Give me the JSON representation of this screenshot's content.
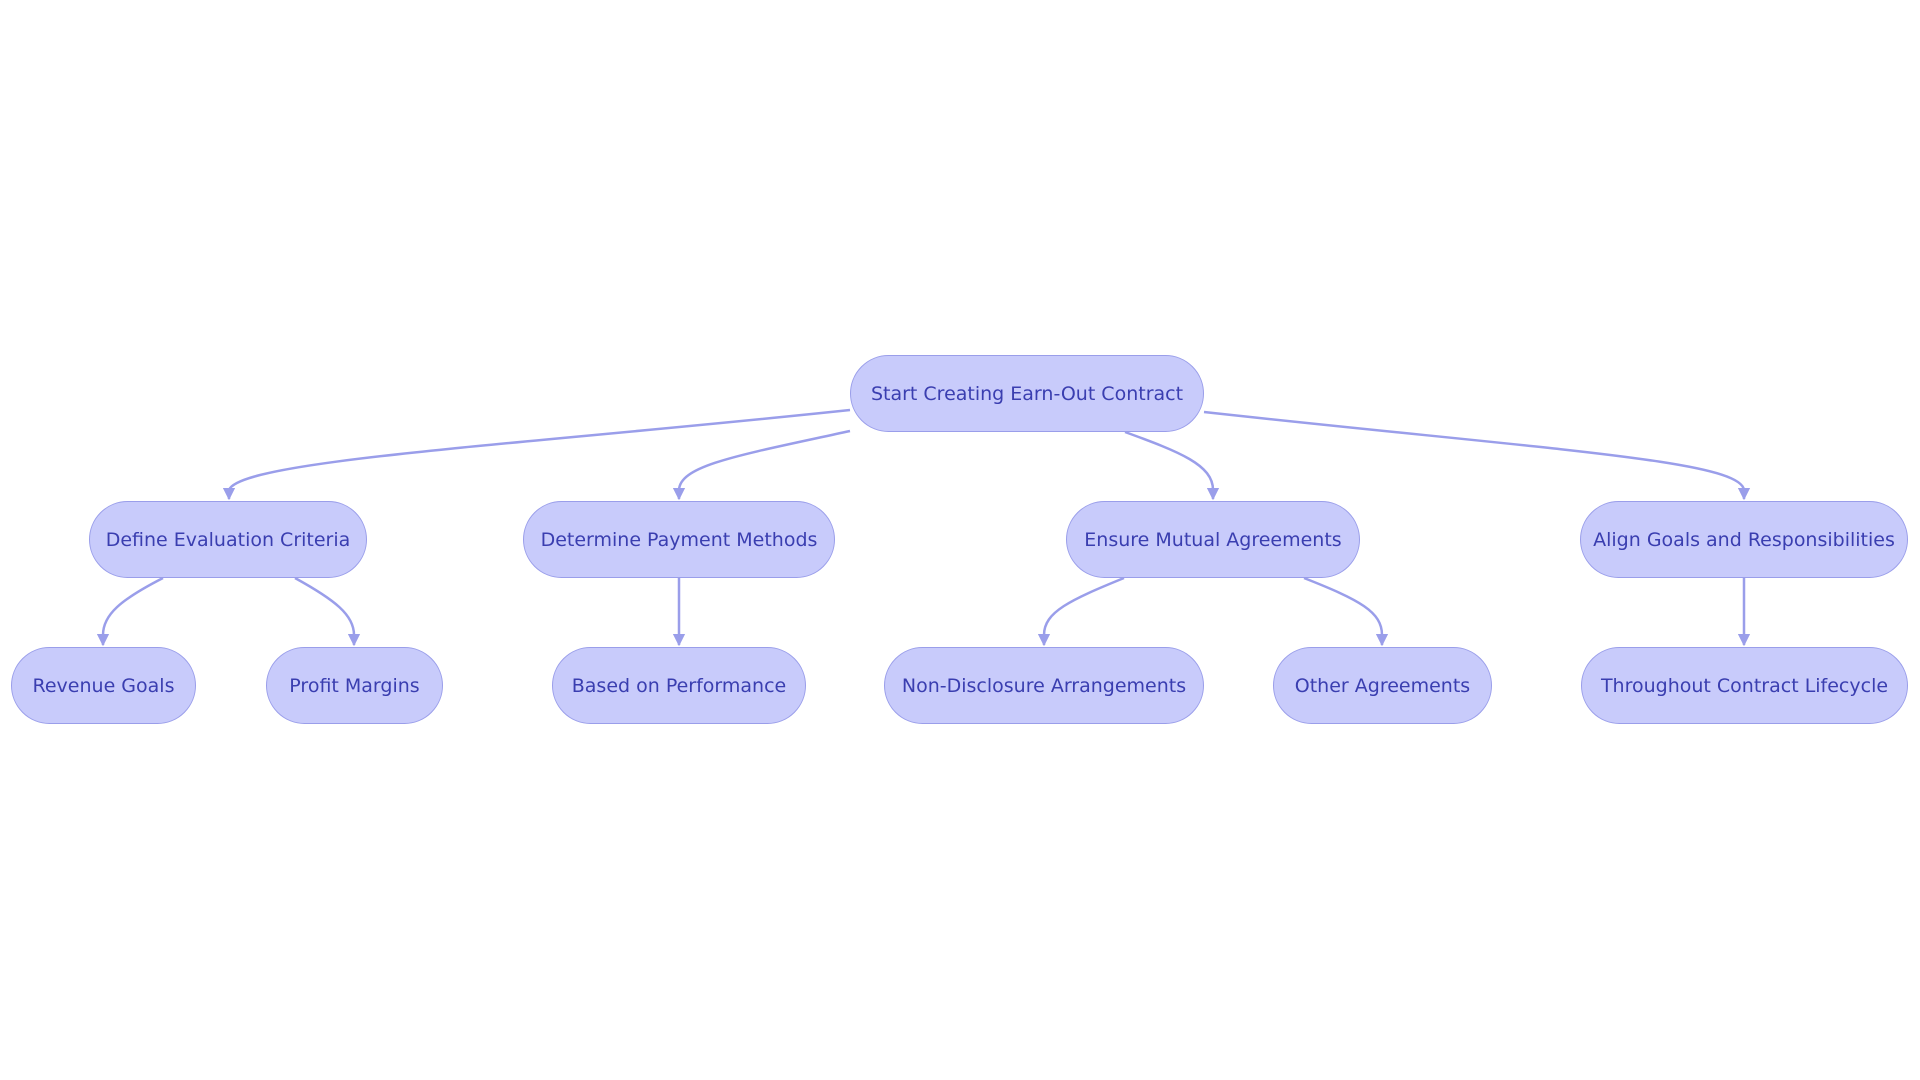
{
  "diagram": {
    "colors": {
      "node_fill": "#c8cbfb",
      "node_border": "#9a9eea",
      "text": "#3a3eb0",
      "edge": "#9a9eea"
    },
    "root": {
      "id": "root",
      "label": "Start Creating Earn-Out Contract"
    },
    "nodes": [
      {
        "id": "define",
        "label": "Define Evaluation Criteria",
        "parent": "root"
      },
      {
        "id": "payment",
        "label": "Determine Payment Methods",
        "parent": "root"
      },
      {
        "id": "mutual",
        "label": "Ensure Mutual Agreements",
        "parent": "root"
      },
      {
        "id": "align",
        "label": "Align Goals and Responsibilities",
        "parent": "root"
      },
      {
        "id": "revenue",
        "label": "Revenue Goals",
        "parent": "define"
      },
      {
        "id": "profit",
        "label": "Profit Margins",
        "parent": "define"
      },
      {
        "id": "performance",
        "label": "Based on Performance",
        "parent": "payment"
      },
      {
        "id": "nda",
        "label": "Non-Disclosure Arrangements",
        "parent": "mutual"
      },
      {
        "id": "other",
        "label": "Other Agreements",
        "parent": "mutual"
      },
      {
        "id": "lifecycle",
        "label": "Throughout Contract Lifecycle",
        "parent": "align"
      }
    ]
  }
}
